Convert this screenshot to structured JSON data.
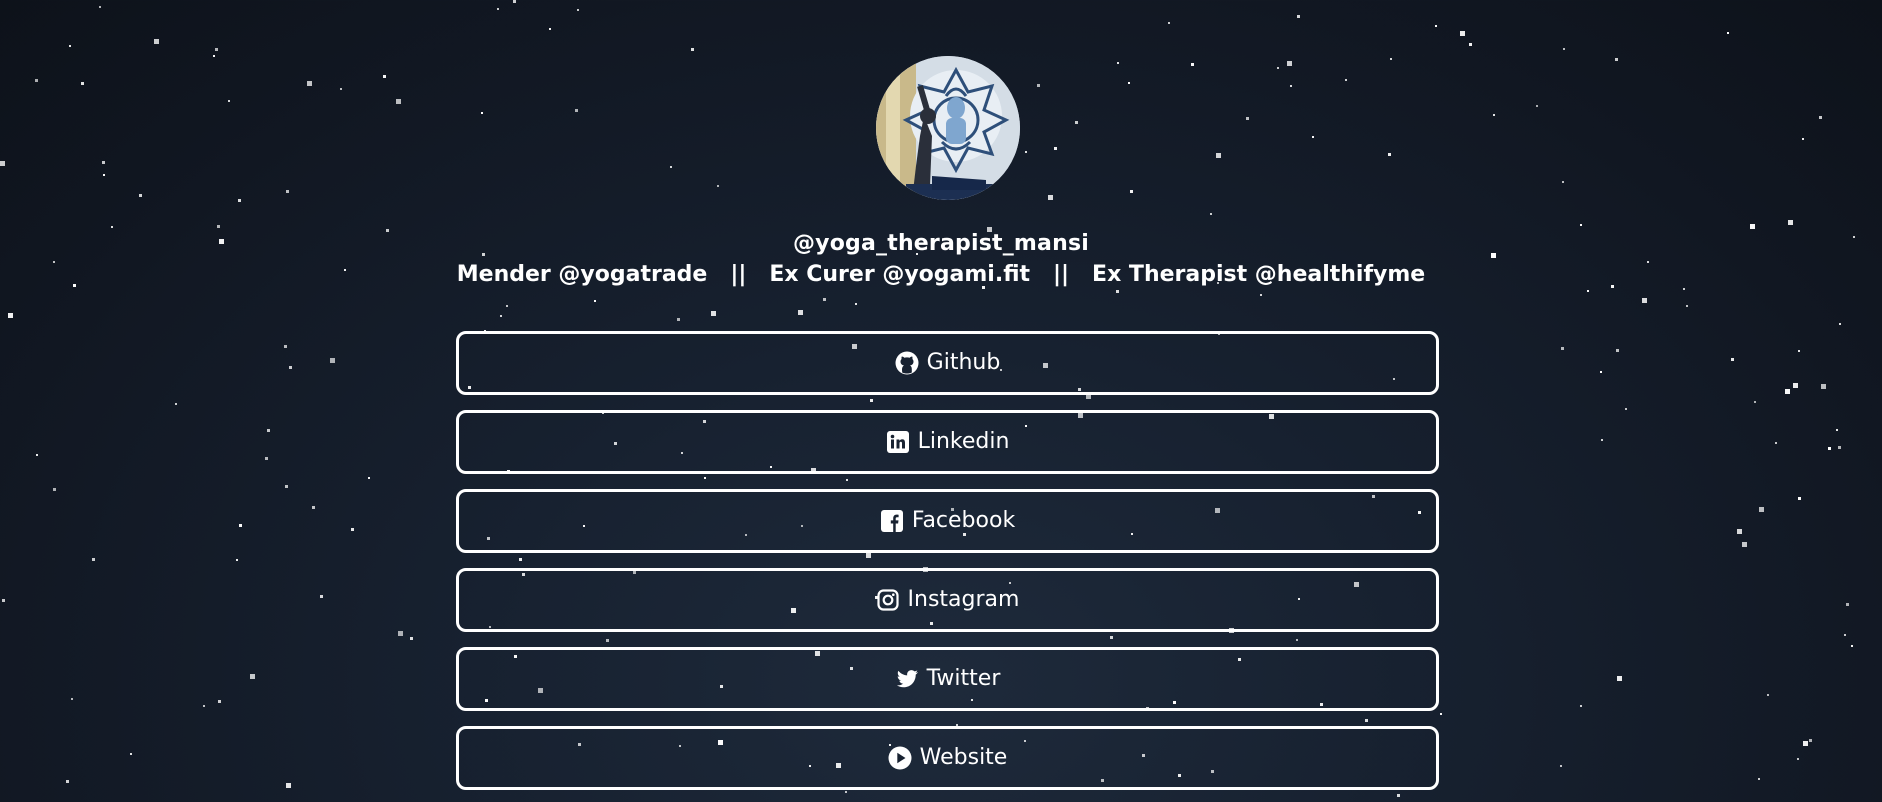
{
  "profile": {
    "username": "@yoga_therapist_mansi",
    "bio": "Mender @yogatrade   ||   Ex Curer @yogami.fit   ||   Ex Therapist @healthifyme"
  },
  "links": [
    {
      "label": "Github",
      "icon": "github-icon"
    },
    {
      "label": "Linkedin",
      "icon": "linkedin-icon"
    },
    {
      "label": "Facebook",
      "icon": "facebook-icon"
    },
    {
      "label": "Instagram",
      "icon": "instagram-icon"
    },
    {
      "label": "Twitter",
      "icon": "twitter-icon"
    },
    {
      "label": "Website",
      "icon": "play-circle-icon"
    }
  ],
  "colors": {
    "background": "#141b26",
    "text": "#ffffff",
    "button_border": "#ffffff"
  }
}
